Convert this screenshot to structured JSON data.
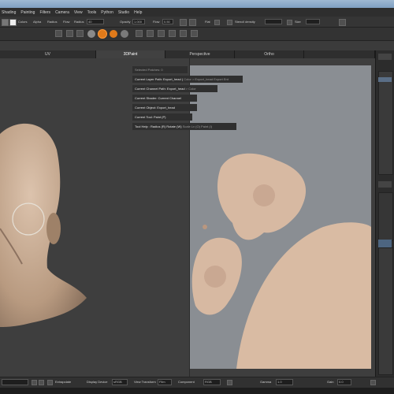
{
  "menu": [
    "Shading",
    "Painting",
    "Filters",
    "Camera",
    "View",
    "Tools",
    "Python",
    "Studio",
    "Help"
  ],
  "toolbar1": {
    "colors_label": "Colors",
    "alpha_label": "Alpha",
    "radius_label": "Radius",
    "flow_label": "Flow",
    "radius2_label": "Radius",
    "radius2_value": "40",
    "opacity_label": "Opacity",
    "opacity_value": "1.000",
    "flow2_label": "Flow",
    "flow2_value": "0.50",
    "flat_label": "Flat",
    "shadow_label": "Stencil density",
    "size_label": "Size"
  },
  "tabs": [
    "UV",
    "3DPaint",
    "Perspective",
    "Ortho"
  ],
  "overlay": [
    {
      "label": "Selected Patches: 0",
      "value": ""
    },
    {
      "label": "Current Layer Path: Export_head (",
      "value": "Color > Export_head Export Ent"
    },
    {
      "label": "Current Channel Path: Export_head",
      "value": "> Color"
    },
    {
      "label": "Current Shader: Current Channel",
      "value": ""
    },
    {
      "label": "Current Object: Export_head",
      "value": ""
    },
    {
      "label": "Current Tool: Paint (P)",
      "value": ""
    },
    {
      "label": "Tool Help : Radius (R) Rotate (W)",
      "value": "Scale Lv (O) Paint (I)"
    }
  ],
  "status": {
    "extrapolate_label": "Extrapolate",
    "display_device_label": "Display Device",
    "display_device_value": "sRGB",
    "view_transform_label": "View Transform",
    "view_transform_value": "Film",
    "component_label": "Component",
    "component_value": "RGB",
    "gamma_label": "Gamma",
    "gamma_value": "1.0",
    "gain_label": "Gain",
    "gain_value": "0.0"
  },
  "colors": {
    "accent": "#e07a1a",
    "skin": "#c9a98d",
    "texture_bg": "#8a8e93"
  }
}
